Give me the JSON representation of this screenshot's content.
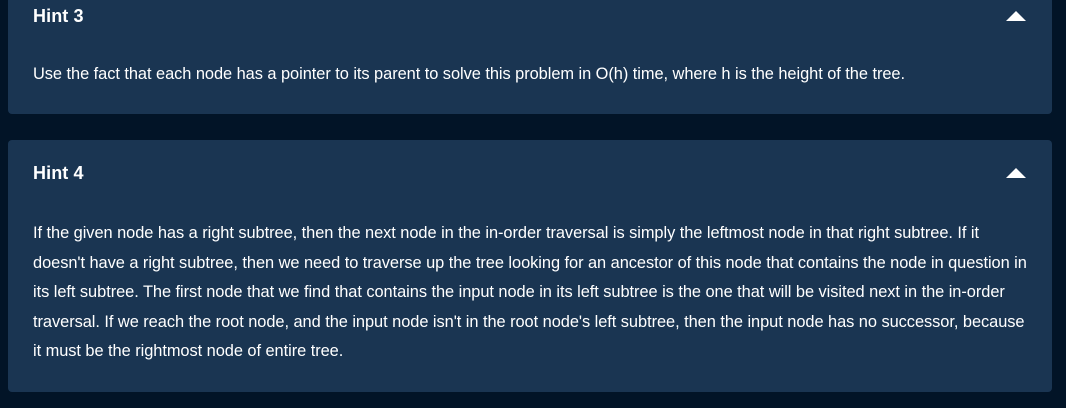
{
  "hints": [
    {
      "title": "Hint 3",
      "body": "Use the fact that each node has a pointer to its parent to solve this problem in O(h) time, where h is the height of the tree.",
      "toggle_icon": "caret-up-icon"
    },
    {
      "title": "Hint 4",
      "body": "If the given node has a right subtree, then the next node in the in-order traversal is simply the leftmost node in that right subtree. If it doesn't have a right subtree, then we need to traverse up the tree looking for an ancestor of this node that contains the node in question in its left subtree. The first node that we find that contains the input node in its left subtree is the one that will be visited next in the in-order traversal. If we reach the root node, and the input node isn't in the root node's left subtree, then the input node has no successor, because it must be the rightmost node of entire tree.",
      "toggle_icon": "caret-up-icon"
    }
  ],
  "colors": {
    "page_background": "#021427",
    "card_background": "#1a3552",
    "text": "#ffffff"
  }
}
